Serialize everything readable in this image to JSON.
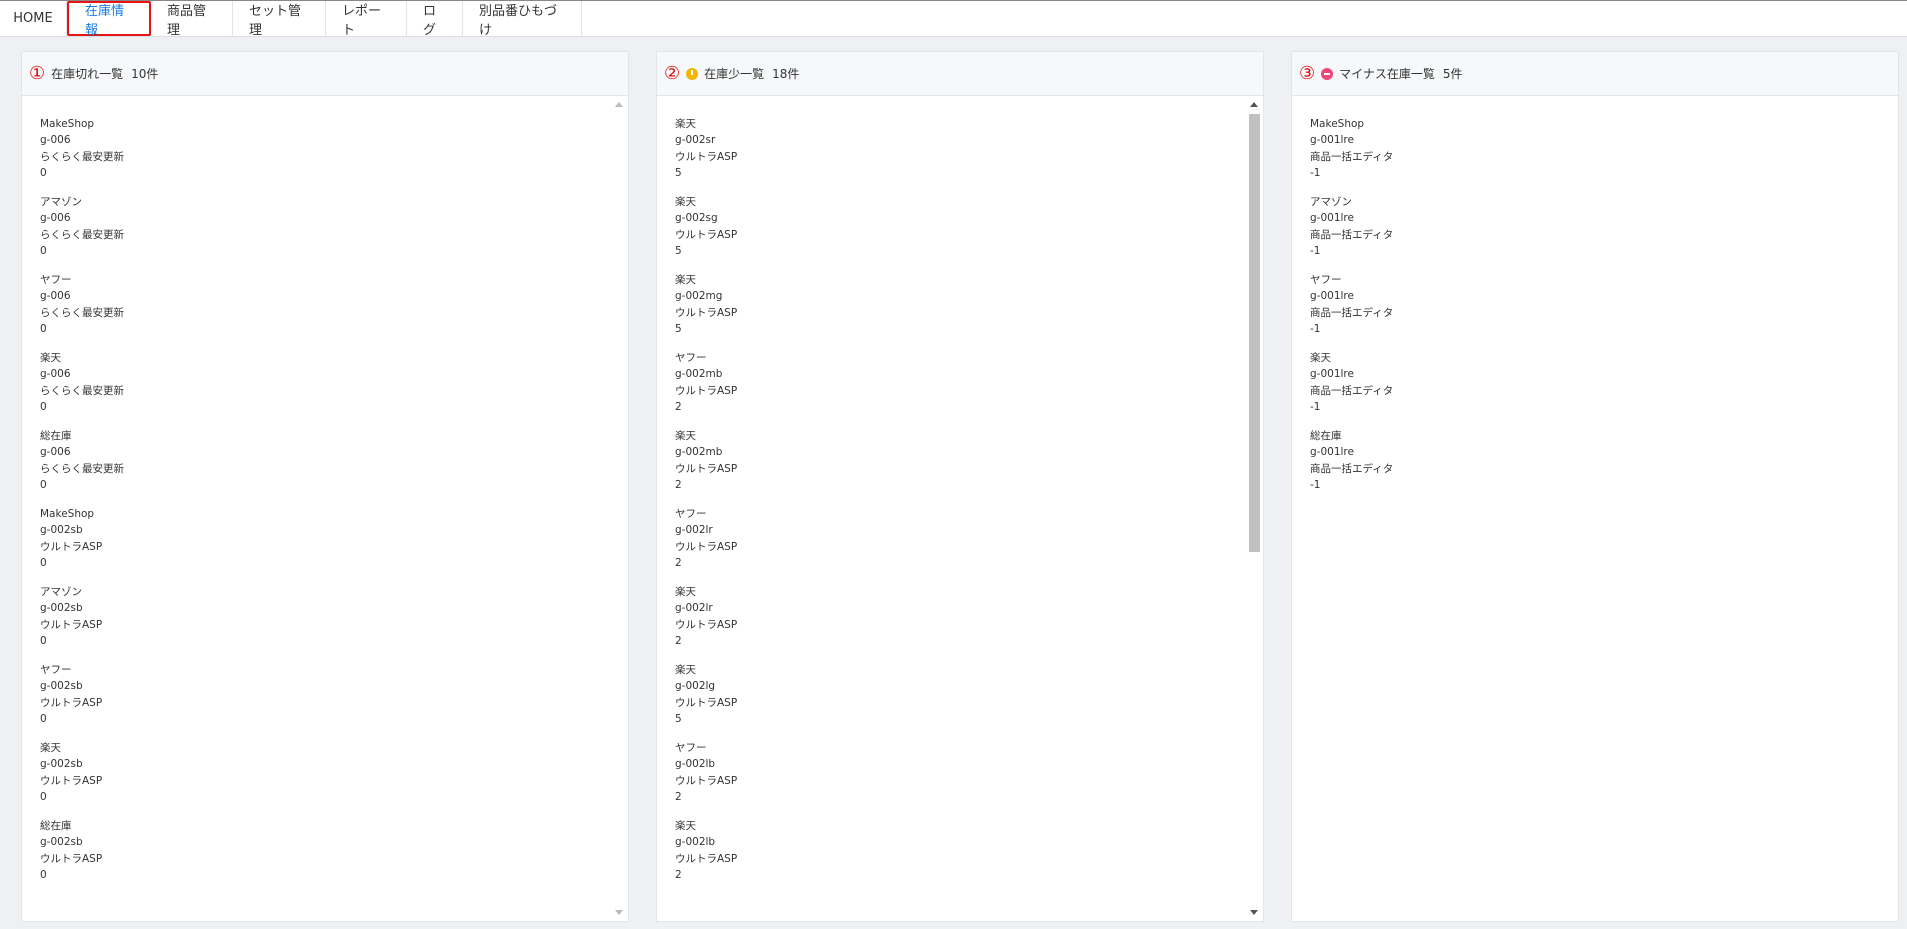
{
  "tabs": [
    {
      "label": "HOME"
    },
    {
      "label": "在庫情報"
    },
    {
      "label": "商品管理"
    },
    {
      "label": "セット管理"
    },
    {
      "label": "レポート"
    },
    {
      "label": "ログ"
    },
    {
      "label": "別品番ひもづけ"
    }
  ],
  "panels": [
    {
      "number": "①",
      "title": "在庫切れ一覧",
      "count": "10件",
      "items": [
        {
          "shop": "MakeShop",
          "code": "g-006",
          "tool": "らくらく最安更新",
          "qty": "0"
        },
        {
          "shop": "アマゾン",
          "code": "g-006",
          "tool": "らくらく最安更新",
          "qty": "0"
        },
        {
          "shop": "ヤフー",
          "code": "g-006",
          "tool": "らくらく最安更新",
          "qty": "0"
        },
        {
          "shop": "楽天",
          "code": "g-006",
          "tool": "らくらく最安更新",
          "qty": "0"
        },
        {
          "shop": "総在庫",
          "code": "g-006",
          "tool": "らくらく最安更新",
          "qty": "0"
        },
        {
          "shop": "MakeShop",
          "code": "g-002sb",
          "tool": "ウルトラASP",
          "qty": "0"
        },
        {
          "shop": "アマゾン",
          "code": "g-002sb",
          "tool": "ウルトラASP",
          "qty": "0"
        },
        {
          "shop": "ヤフー",
          "code": "g-002sb",
          "tool": "ウルトラASP",
          "qty": "0"
        },
        {
          "shop": "楽天",
          "code": "g-002sb",
          "tool": "ウルトラASP",
          "qty": "0"
        },
        {
          "shop": "総在庫",
          "code": "g-002sb",
          "tool": "ウルトラASP",
          "qty": "0"
        }
      ]
    },
    {
      "number": "②",
      "icon": "warning-icon",
      "title": "在庫少一覧",
      "count": "18件",
      "items": [
        {
          "shop": "楽天",
          "code": "g-002sr",
          "tool": "ウルトラASP",
          "qty": "5"
        },
        {
          "shop": "楽天",
          "code": "g-002sg",
          "tool": "ウルトラASP",
          "qty": "5"
        },
        {
          "shop": "楽天",
          "code": "g-002mg",
          "tool": "ウルトラASP",
          "qty": "5"
        },
        {
          "shop": "ヤフー",
          "code": "g-002mb",
          "tool": "ウルトラASP",
          "qty": "2"
        },
        {
          "shop": "楽天",
          "code": "g-002mb",
          "tool": "ウルトラASP",
          "qty": "2"
        },
        {
          "shop": "ヤフー",
          "code": "g-002lr",
          "tool": "ウルトラASP",
          "qty": "2"
        },
        {
          "shop": "楽天",
          "code": "g-002lr",
          "tool": "ウルトラASP",
          "qty": "2"
        },
        {
          "shop": "楽天",
          "code": "g-002lg",
          "tool": "ウルトラASP",
          "qty": "5"
        },
        {
          "shop": "ヤフー",
          "code": "g-002lb",
          "tool": "ウルトラASP",
          "qty": "2"
        },
        {
          "shop": "楽天",
          "code": "g-002lb",
          "tool": "ウルトラASP",
          "qty": "2"
        }
      ]
    },
    {
      "number": "③",
      "icon": "minus-circle-icon",
      "title": "マイナス在庫一覧",
      "count": "5件",
      "items": [
        {
          "shop": "MakeShop",
          "code": "g-001lre",
          "tool": "商品一括エディタ",
          "qty": "-1"
        },
        {
          "shop": "アマゾン",
          "code": "g-001lre",
          "tool": "商品一括エディタ",
          "qty": "-1"
        },
        {
          "shop": "ヤフー",
          "code": "g-001lre",
          "tool": "商品一括エディタ",
          "qty": "-1"
        },
        {
          "shop": "楽天",
          "code": "g-001lre",
          "tool": "商品一括エディタ",
          "qty": "-1"
        },
        {
          "shop": "総在庫",
          "code": "g-001lre",
          "tool": "商品一括エディタ",
          "qty": "-1"
        }
      ]
    }
  ]
}
